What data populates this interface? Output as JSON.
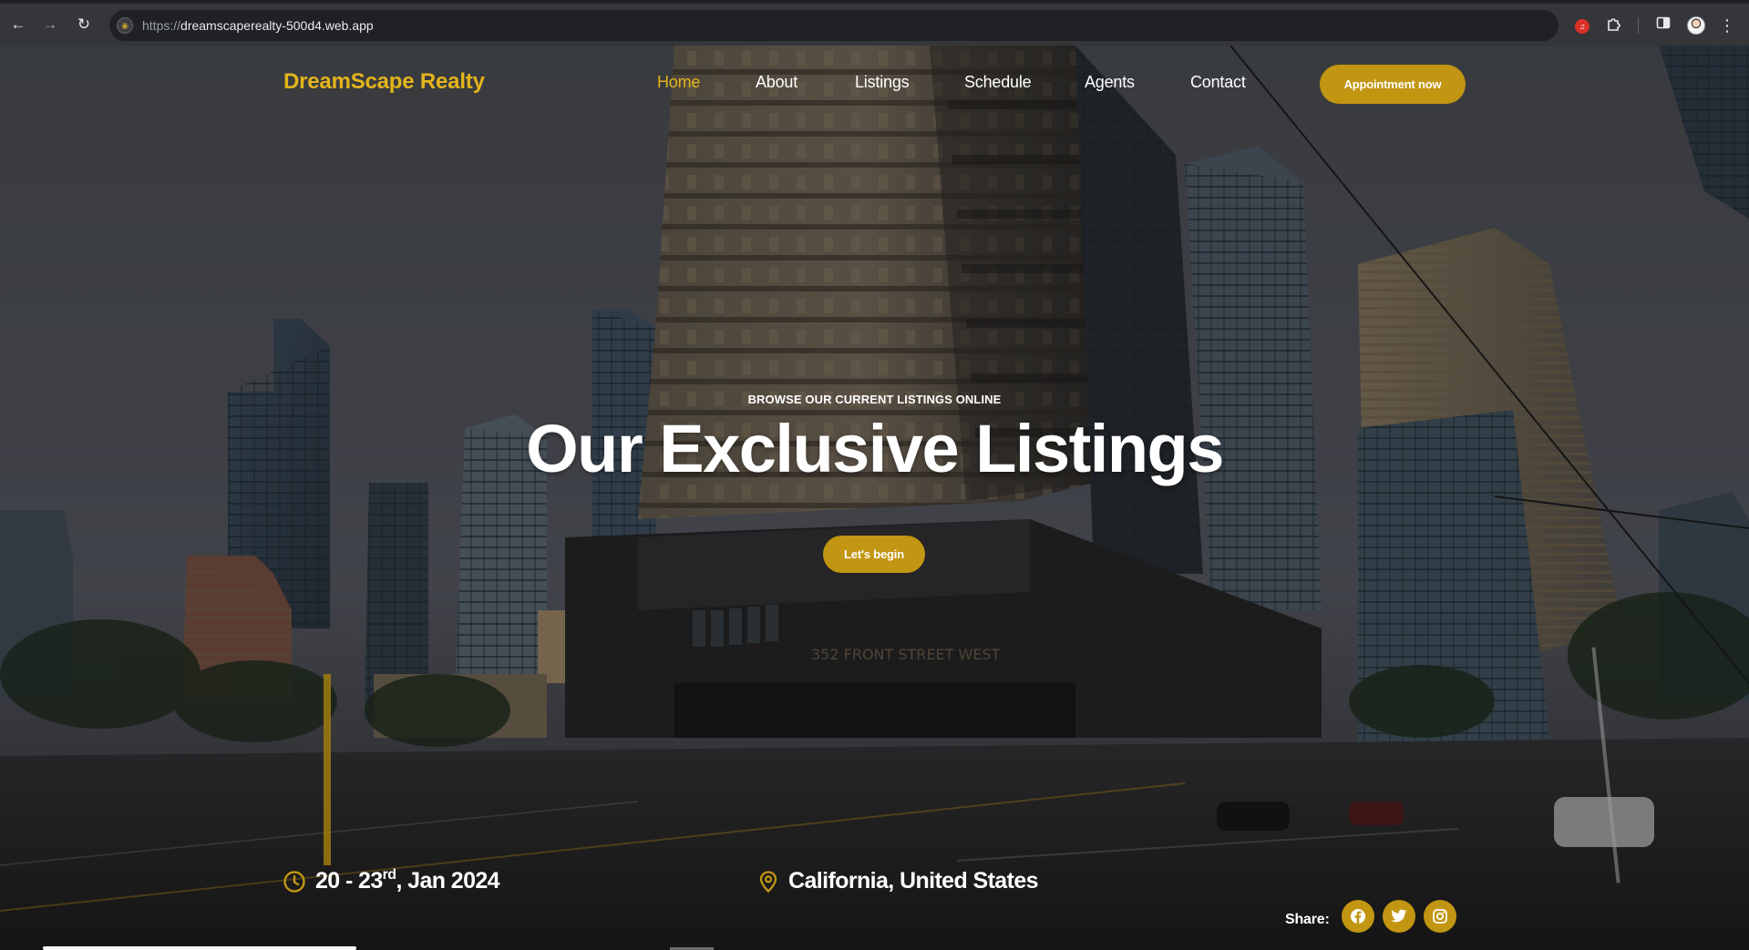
{
  "browser": {
    "url_scheme": "https://",
    "url_host": "dreamscaperealty-500d4.web.app",
    "icons": [
      "back-icon",
      "forward-icon",
      "reload-icon",
      "site-info-icon",
      "extension-badge-icon",
      "extensions-puzzle-icon",
      "side-panel-icon",
      "profile-avatar",
      "kebab-menu-icon"
    ]
  },
  "header": {
    "brand": "DreamScape Realty",
    "nav": [
      {
        "label": "Home",
        "active": true
      },
      {
        "label": "About",
        "active": false
      },
      {
        "label": "Listings",
        "active": false
      },
      {
        "label": "Schedule",
        "active": false
      },
      {
        "label": "Agents",
        "active": false
      },
      {
        "label": "Contact",
        "active": false
      }
    ],
    "cta_label": "Appointment now"
  },
  "hero": {
    "eyebrow": "BROWSE OUR CURRENT LISTINGS ONLINE",
    "title": "Our Exclusive Listings",
    "button_label": "Let's begin",
    "building_sign": "352 FRONT STREET WEST"
  },
  "info_bar": {
    "date_main": "20 - 23",
    "date_sup": "rd",
    "date_rest": ", Jan 2024",
    "location": "California, United States",
    "share_label": "Share:",
    "socials": [
      "facebook-icon",
      "twitter-icon",
      "instagram-icon"
    ]
  },
  "colors": {
    "accent": "#c29612",
    "brand_text": "#e4b41c",
    "text": "#ffffff"
  }
}
